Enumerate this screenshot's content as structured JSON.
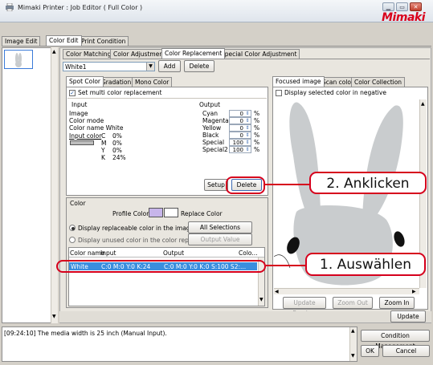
{
  "window": {
    "title": "Mimaki Printer : Job Editor ( Full Color )",
    "logo": "Mimaki"
  },
  "main_tabs": [
    "Image Edit",
    "Color Edit",
    "Print Condition"
  ],
  "sub_tabs": [
    "Color Matching",
    "Color Adjustment",
    "Color Replacement",
    "Special Color Adjustment"
  ],
  "selector": {
    "value": "White1",
    "add": "Add",
    "delete": "Delete"
  },
  "left_tabs": [
    "Spot Color",
    "Gradation",
    "Mono Color"
  ],
  "spot": {
    "set_multi": "Set multi color replacement",
    "input_header": "Input",
    "output_header": "Output",
    "image_label": "Image",
    "color_mode_label": "Color mode",
    "color_name": "Color name White",
    "input_color_label": "Input color",
    "input_values": [
      [
        "C",
        "0%"
      ],
      [
        "M",
        "0%"
      ],
      [
        "Y",
        "0%"
      ],
      [
        "K",
        "24%"
      ]
    ],
    "output_rows": [
      {
        "name": "Cyan",
        "value": "0"
      },
      {
        "name": "Magenta",
        "value": "0"
      },
      {
        "name": "Yellow",
        "value": "0"
      },
      {
        "name": "Black",
        "value": "0"
      },
      {
        "name": "Special",
        "value": "100"
      },
      {
        "name": "Special2",
        "value": "100"
      }
    ],
    "percent": "%",
    "setup": "Setup",
    "delete": "Delete"
  },
  "color_section": {
    "title": "Color",
    "profile_color": "Profile Color",
    "replace_color": "Replace Color",
    "radio1": "Display replaceable color in the image",
    "radio2": "Display unused color in the color replac...",
    "all_selections": "All Selections",
    "output_value_acq": "Output Value Acquisition",
    "table_headers": [
      "Color name",
      "Input",
      "Output",
      "Colo..."
    ],
    "row": {
      "name": "White",
      "input": "C:0 M:0 Y:0 K:24",
      "output": "C:0 M:0 Y:0 K:0 S:100 S2:..."
    }
  },
  "right_tabs": [
    "Focused image",
    "Scan color",
    "Color Collection"
  ],
  "preview": {
    "negative": "Display selected color in negative",
    "update_preview": "Update Preview",
    "zoom_out": "Zoom Out",
    "zoom_in": "Zoom In",
    "update": "Update"
  },
  "log": {
    "message": "[09:24:10] The media width is 25 inch (Manual Input)."
  },
  "footer": {
    "condition_mgmt": "Condition Management",
    "ok": "OK",
    "cancel": "Cancel"
  },
  "callouts": {
    "click": "2. Anklicken",
    "select": "1. Auswählen"
  },
  "colors": {
    "accent_red": "#d6001c",
    "selection_blue": "#3a8ede",
    "rabbit_grey": "#c9ccce"
  }
}
